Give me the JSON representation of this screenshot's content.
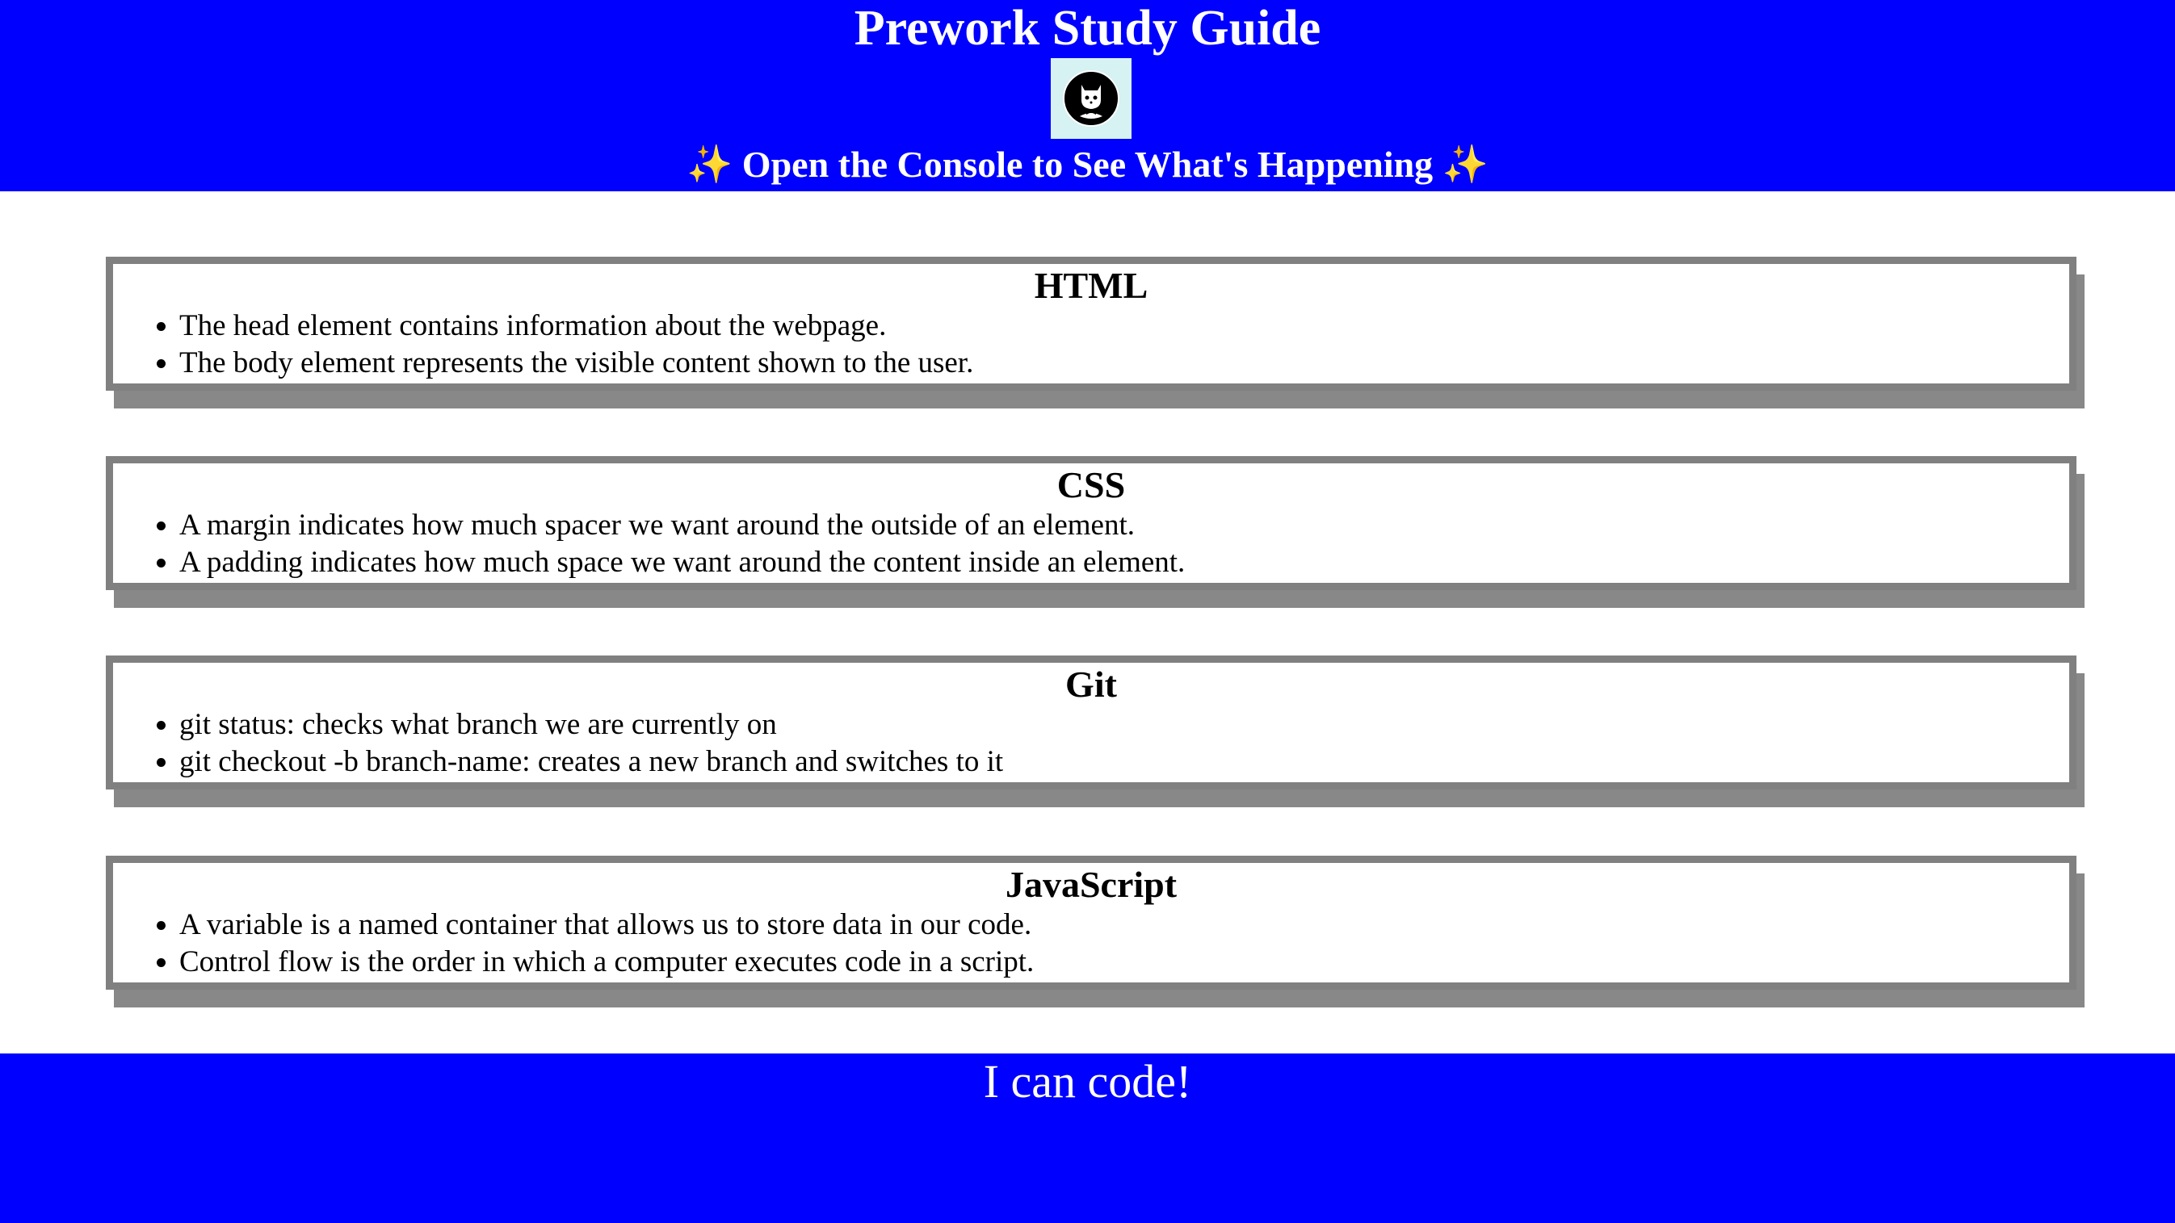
{
  "header": {
    "title": "Prework Study Guide",
    "logo_icon": "cat-with-bowtie-logo",
    "subtitle": "✨ Open the Console to See What's Happening ✨"
  },
  "sections": [
    {
      "title": "HTML",
      "items": [
        "The head element contains information about the webpage.",
        "The body element represents the visible content shown to the user."
      ]
    },
    {
      "title": "CSS",
      "items": [
        "A margin indicates how much spacer we want around the outside of an element.",
        "A padding indicates how much space we want around the content inside an element."
      ]
    },
    {
      "title": "Git",
      "items": [
        "git status: checks what branch we are currently on",
        "git checkout -b branch-name: creates a new branch and switches to it"
      ]
    },
    {
      "title": "JavaScript",
      "items": [
        "A variable is a named container that allows us to store data in our code.",
        "Control flow is the order in which a computer executes code in a script."
      ]
    }
  ],
  "footer": {
    "text": "I can code!"
  },
  "colors": {
    "header_bg": "#0000ff",
    "border": "#808080",
    "shadow": "#888888"
  }
}
